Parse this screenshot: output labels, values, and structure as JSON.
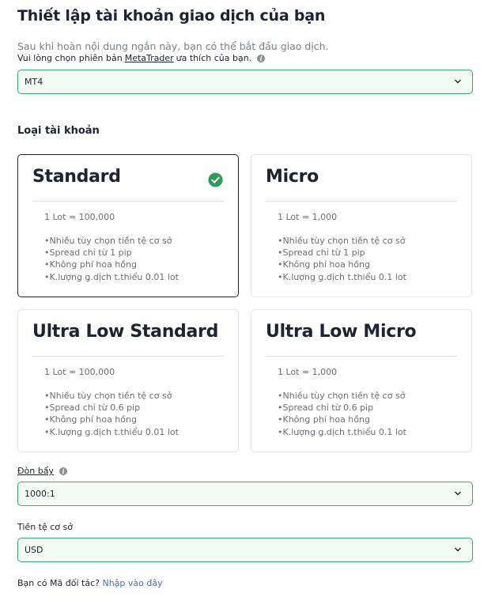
{
  "header": {
    "title": "Thiết lập tài khoản giao dịch của bạn",
    "subtitle": "Sau khi hoàn nội dung ngắn này, bạn có thể bắt đầu giao dịch.",
    "hint_prefix": "Vui lòng chọn phiên bản",
    "hint_link": "MetaTrader",
    "hint_suffix": "ưa thích của bạn."
  },
  "platform_select": {
    "value": "MT4"
  },
  "account_types": {
    "title": "Loại tài khoản",
    "cards": [
      {
        "name": "Standard",
        "lot": "1 Lot = 100,000",
        "selected": true,
        "features": [
          "Nhiều tùy chọn tiền tệ cơ sở",
          "Spread chỉ từ 1 pip",
          "Không phí hoa hồng",
          "K.lượng g.dịch t.thiểu 0.01 lot"
        ]
      },
      {
        "name": "Micro",
        "lot": "1 Lot = 1,000",
        "selected": false,
        "features": [
          "Nhiều tùy chọn tiền tệ cơ sở",
          "Spread chỉ từ 1 pip",
          "Không phí hoa hồng",
          "K.lượng g.dịch t.thiểu 0.1 lot"
        ]
      },
      {
        "name": "Ultra Low Standard",
        "lot": "1 Lot = 100,000",
        "selected": false,
        "features": [
          "Nhiều tùy chọn tiền tệ cơ sở",
          "Spread chỉ từ 0.6 pip",
          "Không phí hoa hồng",
          "K.lượng g.dịch t.thiểu 0.01 lot"
        ]
      },
      {
        "name": "Ultra Low Micro",
        "lot": "1 Lot = 1,000",
        "selected": false,
        "features": [
          "Nhiều tùy chọn tiền tệ cơ sở",
          "Spread chỉ từ 0.6 pip",
          "Không phí hoa hồng",
          "K.lượng g.dịch t.thiểu 0.1 lot"
        ]
      }
    ]
  },
  "leverage": {
    "label": "Đòn bẩy",
    "value": "1000:1"
  },
  "base_currency": {
    "label": "Tiền tệ cơ sở",
    "value": "USD"
  },
  "partner": {
    "question": "Bạn có Mã đối tác?",
    "link": "Nhập vào đây"
  },
  "colors": {
    "accent_green": "#3daa6a",
    "check_green": "#2e9b5c",
    "field_bg": "#f3fbf5",
    "link_blue": "#3d6fd6"
  },
  "icons": {
    "info": "info-icon",
    "chevron": "chevron-down-icon",
    "check": "check-circle-icon"
  }
}
